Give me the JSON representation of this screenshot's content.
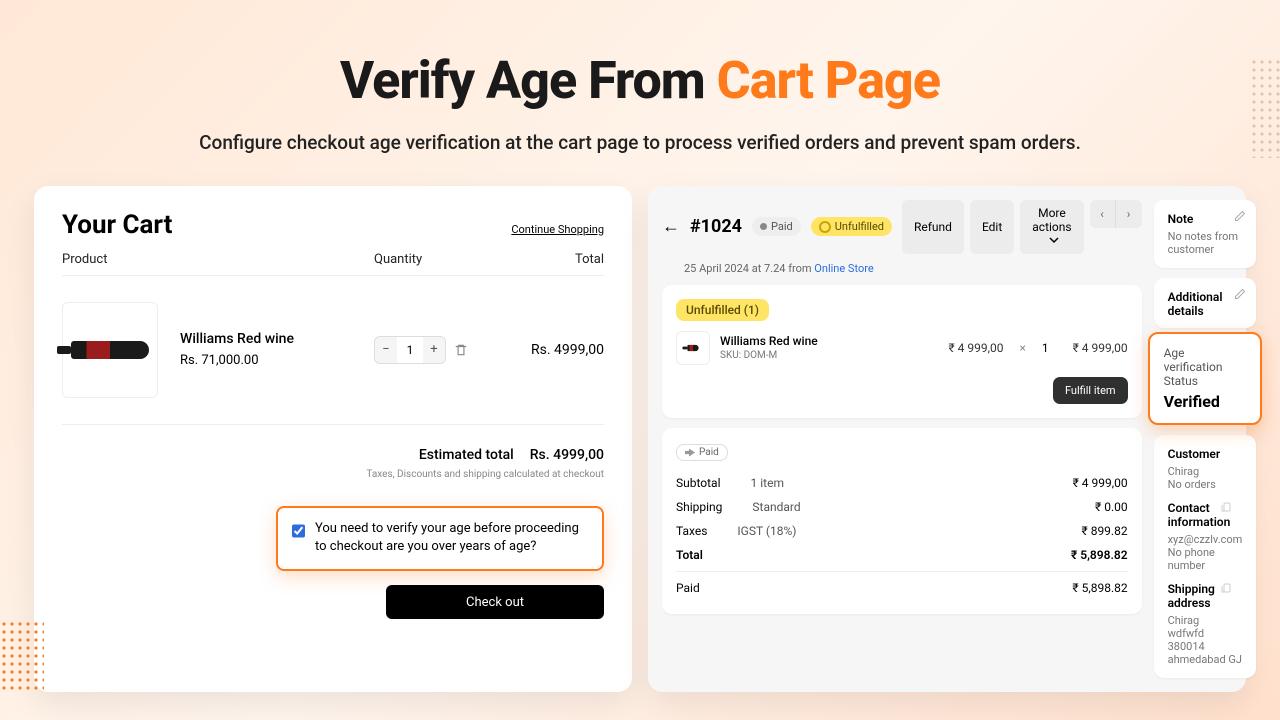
{
  "hero": {
    "title_a": "Verify Age From ",
    "title_b": "Cart Page",
    "subtitle": "Configure checkout age verification at the cart page to process verified orders and prevent spam orders."
  },
  "cart": {
    "title": "Your Cart",
    "continue": "Continue Shopping",
    "cols": {
      "product": "Product",
      "quantity": "Quantity",
      "total": "Total"
    },
    "item": {
      "title": "Williams Red wine",
      "price": "Rs. 71,000.00",
      "qty": "1",
      "total": "Rs. 4999,00"
    },
    "est_label": "Estimated total",
    "est_value": "Rs. 4999,00",
    "tax_note": "Taxes, Discounts and shipping calculated at checkout",
    "verify_text": "You need to verify your age before proceeding to checkout are you over years of age?",
    "checkout": "Check out"
  },
  "order": {
    "id": "#1024",
    "paid": "Paid",
    "unfulfilled": "Unfulfilled",
    "buttons": {
      "refund": "Refund",
      "edit": "Edit",
      "more": "More actions"
    },
    "date": "25 April 2024 at 7.24 from ",
    "source": "Online Store",
    "unful_tag": "Unfulfilled (1)",
    "line": {
      "title": "Williams Red wine",
      "sku": "SKU: DOM-M",
      "price": "₹ 4 999,00",
      "qty": "1",
      "total": "₹ 4 999,00"
    },
    "fulfill": "Fulfill item",
    "paid_tag": "Paid",
    "totals": {
      "subtotal": {
        "l": "Subtotal",
        "m": "1 item",
        "v": "₹ 4 999,00"
      },
      "shipping": {
        "l": "Shipping",
        "m": "Standard",
        "v": "₹ 0.00"
      },
      "taxes": {
        "l": "Taxes",
        "m": "IGST (18%)",
        "v": "₹ 899.82"
      },
      "total": {
        "l": "Total",
        "v": "₹ 5,898.82"
      },
      "paid": {
        "l": "Paid",
        "v": "₹ 5,898.82"
      }
    }
  },
  "side": {
    "note": {
      "h": "Note",
      "p": "No notes from customer"
    },
    "additional": {
      "h": "Additional details"
    },
    "verify": {
      "h": "Age verification Status",
      "v": "Verified"
    },
    "customer": {
      "h": "Customer",
      "name": "Chirag",
      "orders": "No orders"
    },
    "contact": {
      "h": "Contact information",
      "email": "xyz@czzlv.com",
      "phone": "No phone number"
    },
    "shipping": {
      "h": "Shipping address",
      "l1": "Chirag",
      "l2": "wdfwfd",
      "l3": "380014 ahmedabad GJ"
    }
  }
}
